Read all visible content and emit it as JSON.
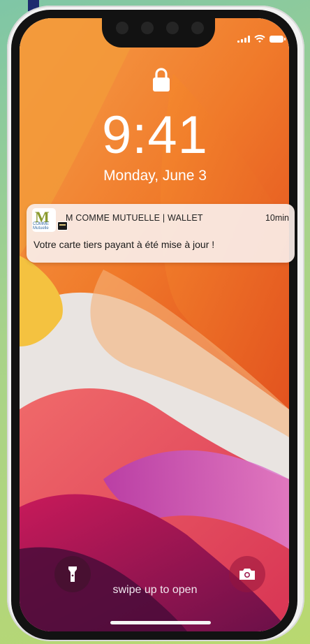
{
  "status_bar": {
    "signal_icon": "cellular-signal-icon",
    "wifi_icon": "wifi-icon",
    "battery_icon": "battery-icon"
  },
  "lock_screen": {
    "lock_icon": "lock-icon",
    "time": "9:41",
    "date": "Monday, June 3",
    "swipe_hint": "swipe up to open",
    "flashlight_icon": "flashlight-icon",
    "camera_icon": "camera-icon"
  },
  "notification": {
    "app_icon_letter": "M",
    "app_icon_subtext": "COMME Mutuelle",
    "app_name": "M COMME MUTUELLE  | WALLET",
    "age": "10min",
    "message": "Votre carte tiers payant à été mise à jour !",
    "badge_icon": "wallet-card-icon"
  },
  "colors": {
    "page_background": "#a8d38a",
    "accent_bar": "#1e2a6e",
    "wallpaper_orange": "#f07a2a",
    "wallpaper_magenta": "#a0206a"
  }
}
